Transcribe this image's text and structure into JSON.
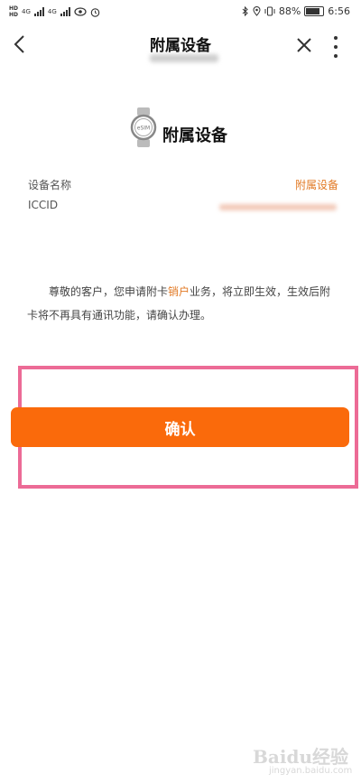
{
  "status_bar": {
    "left_labels": [
      "HD",
      "HD"
    ],
    "network_1": "4G",
    "network_2": "4G",
    "battery_percent": "88%",
    "time": "6:56"
  },
  "header": {
    "back_icon": "chevron-left-icon",
    "title": "附属设备",
    "close_icon": "close-icon",
    "more_icon": "more-vertical-icon"
  },
  "device": {
    "icon": "watch-icon",
    "icon_label": "eSIM",
    "title": "附属设备"
  },
  "info": {
    "name_label": "设备名称",
    "name_value": "附属设备",
    "iccid_label": "ICCID"
  },
  "notice": {
    "text_before": "尊敬的客户，您申请附卡",
    "highlight": "销户",
    "text_after": "业务，将立即生效，生效后附卡将不再具有通讯功能，请确认办理。"
  },
  "confirm": {
    "label": "确认"
  },
  "colors": {
    "accent_orange": "#fa6a0b",
    "value_orange": "#e27a25",
    "highlight_pink": "#ec6b96"
  },
  "watermark": {
    "main": "Baidu经验",
    "sub": "jingyan.baidu.com"
  }
}
